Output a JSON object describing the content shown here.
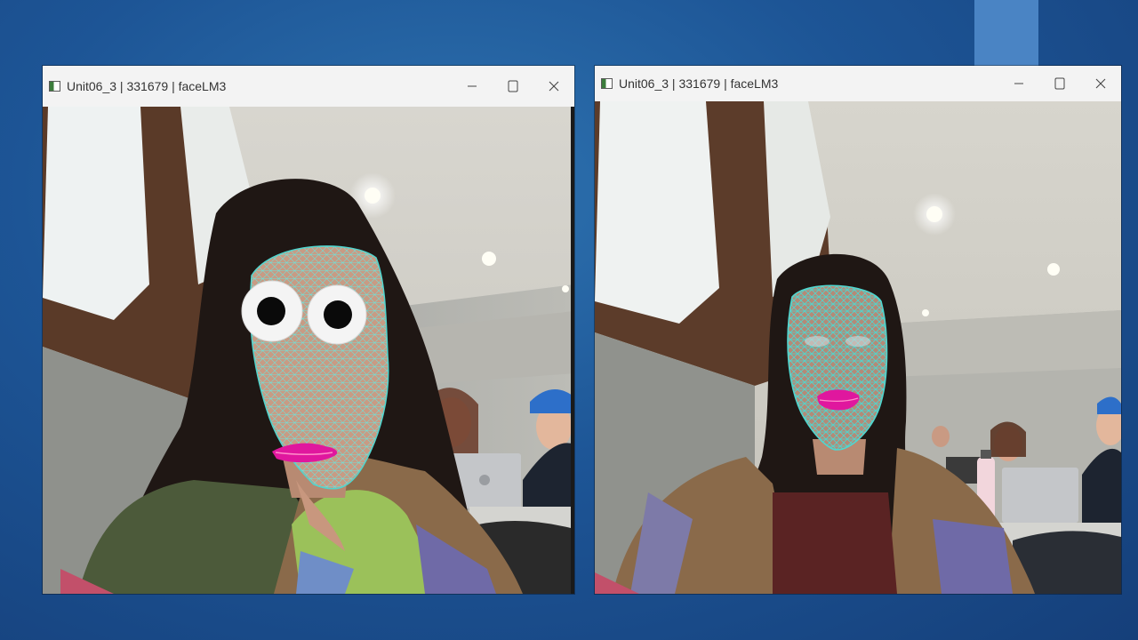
{
  "slide": {
    "background_color": "#1d5596",
    "accent_color": "#4a84c4"
  },
  "windows": [
    {
      "title": "Unit06_3 | 331679 | faceLM3",
      "icon": "app-window-icon",
      "controls": [
        "minimize-icon",
        "maximize-icon",
        "close-icon"
      ],
      "content": "webcam feed: person with face landmark mesh, cartoon eyes and magenta lips"
    },
    {
      "title": "Unit06_3 | 331679 | faceLM3",
      "icon": "app-window-icon",
      "controls": [
        "minimize-icon",
        "maximize-icon",
        "close-icon"
      ],
      "content": "webcam feed: person with cyan face landmark mesh and magenta lips"
    }
  ],
  "colors": {
    "mesh": "#4fd6cf",
    "lips": "#e0179e",
    "eye_white": "#f4f4f4",
    "pupil": "#0a0a0a"
  }
}
